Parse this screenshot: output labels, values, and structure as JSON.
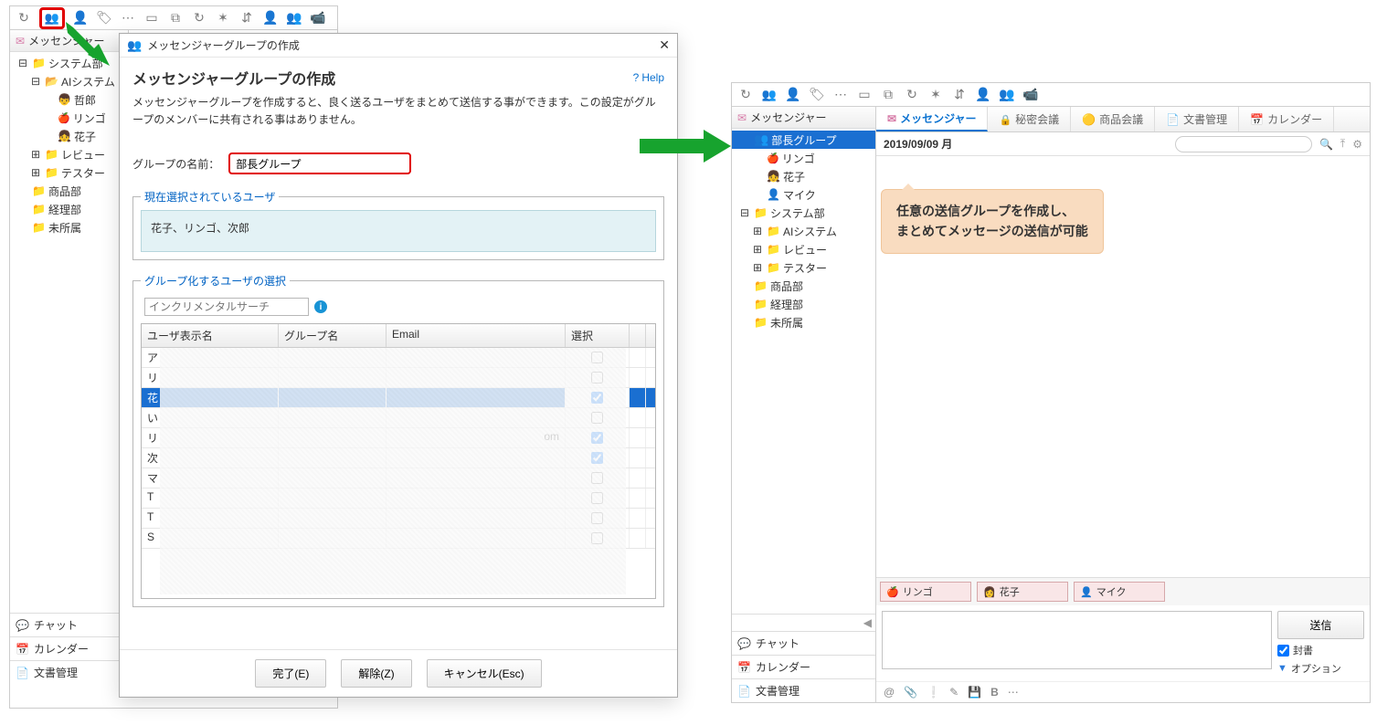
{
  "left": {
    "sidebar_title": "メッセンジャー",
    "tree": [
      {
        "indent": 0,
        "icon": "i-folder",
        "label": "システム部",
        "expand": "−"
      },
      {
        "indent": 1,
        "icon": "i-folder-o",
        "label": "AIシステム",
        "expand": "−"
      },
      {
        "indent": 2,
        "icon": "i-boy",
        "label": "哲郎"
      },
      {
        "indent": 2,
        "icon": "i-apple",
        "label": "リンゴ"
      },
      {
        "indent": 2,
        "icon": "i-girl",
        "label": "花子"
      },
      {
        "indent": 1,
        "icon": "i-folder",
        "label": "レビュー",
        "expand": "+"
      },
      {
        "indent": 1,
        "icon": "i-folder",
        "label": "テスター",
        "expand": "+"
      },
      {
        "indent": 0,
        "icon": "i-folder",
        "label": "商品部"
      },
      {
        "indent": 0,
        "icon": "i-folder",
        "label": "経理部"
      },
      {
        "indent": 0,
        "icon": "i-folder",
        "label": "未所属"
      }
    ],
    "nav": [
      {
        "icon": "i-chat",
        "label": "チャット"
      },
      {
        "icon": "i-cal",
        "label": "カレンダー"
      },
      {
        "icon": "i-doc",
        "label": "文書管理"
      }
    ]
  },
  "dialog": {
    "window_title": "メッセンジャーグループの作成",
    "heading": "メッセンジャーグループの作成",
    "help": "Help",
    "description": "メッセンジャーグループを作成すると、良く送るユーザをまとめて送信する事ができます。この設定がグループのメンバーに共有される事はありません。",
    "group_name_label": "グループの名前：",
    "group_name_value": "部長グループ",
    "selected_legend": "現在選択されているユーザ",
    "selected_users_text": "花子、リンゴ、次郎",
    "usersel_legend": "グループ化するユーザの選択",
    "filter_placeholder": "インクリメンタルサーチ",
    "grid_headers": {
      "c1": "ユーザ表示名",
      "c2": "グループ名",
      "c3": "Email",
      "c4": "選択"
    },
    "grid_rows": [
      {
        "c1": "ア",
        "c3": "",
        "chk": false,
        "sel": false
      },
      {
        "c1": "リ",
        "c3": "",
        "chk": false,
        "sel": false
      },
      {
        "c1": "花",
        "c3": "",
        "chk": true,
        "sel": true
      },
      {
        "c1": "い",
        "c3": "",
        "chk": false,
        "sel": false
      },
      {
        "c1": "リ",
        "c3": "om",
        "chk": true,
        "sel": false
      },
      {
        "c1": "次",
        "c3": "",
        "chk": true,
        "sel": false
      },
      {
        "c1": "マ",
        "c3": "",
        "chk": false,
        "sel": false
      },
      {
        "c1": "T",
        "c3": "",
        "chk": false,
        "sel": false
      },
      {
        "c1": "T",
        "c3": "",
        "chk": false,
        "sel": false
      },
      {
        "c1": "S",
        "c3": "",
        "chk": false,
        "sel": false
      }
    ],
    "buttons": {
      "ok": "完了(E)",
      "clear": "解除(Z)",
      "cancel": "キャンセル(Esc)"
    }
  },
  "right": {
    "sidebar_title": "メッセンジャー",
    "tree": [
      {
        "indent": 0,
        "icon": "i-people",
        "label": "部長グループ",
        "selected": true
      },
      {
        "indent": 1,
        "icon": "i-apple",
        "label": "リンゴ"
      },
      {
        "indent": 1,
        "icon": "i-girl",
        "label": "花子"
      },
      {
        "indent": 1,
        "icon": "i-person",
        "label": "マイク"
      },
      {
        "indent": 0,
        "icon": "i-folder",
        "label": "システム部",
        "expand": "−"
      },
      {
        "indent": 1,
        "icon": "i-folder",
        "label": "AIシステム",
        "expand": "+"
      },
      {
        "indent": 1,
        "icon": "i-folder",
        "label": "レビュー",
        "expand": "+"
      },
      {
        "indent": 1,
        "icon": "i-folder",
        "label": "テスター",
        "expand": "+"
      },
      {
        "indent": 0,
        "icon": "i-folder",
        "label": "商品部"
      },
      {
        "indent": 0,
        "icon": "i-folder",
        "label": "経理部"
      },
      {
        "indent": 0,
        "icon": "i-folder",
        "label": "未所属"
      }
    ],
    "nav": [
      {
        "icon": "i-chat",
        "label": "チャット"
      },
      {
        "icon": "i-cal",
        "label": "カレンダー"
      },
      {
        "icon": "i-doc",
        "label": "文書管理"
      }
    ],
    "tabs": [
      {
        "icon": "i-mail",
        "label": "メッセンジャー",
        "active": true
      },
      {
        "icon": "i-lock",
        "label": "秘密会議"
      },
      {
        "icon": "",
        "label": "商品会議",
        "prefix": "🟡"
      },
      {
        "icon": "i-doc",
        "label": "文書管理",
        "prefix": "📄"
      },
      {
        "icon": "i-cal",
        "label": "カレンダー",
        "prefix": "📅"
      }
    ],
    "date": "2019/09/09 月",
    "callout_l1": "任意の送信グループを作成し、",
    "callout_l2": "まとめてメッセージの送信が可能",
    "recipients": [
      {
        "icon": "i-apple",
        "label": "リンゴ"
      },
      {
        "icon": "i-girl2",
        "label": "花子"
      },
      {
        "icon": "i-person",
        "label": "マイク"
      }
    ],
    "send": "送信",
    "opt_seal": "封書",
    "opt_option": "オプション"
  }
}
